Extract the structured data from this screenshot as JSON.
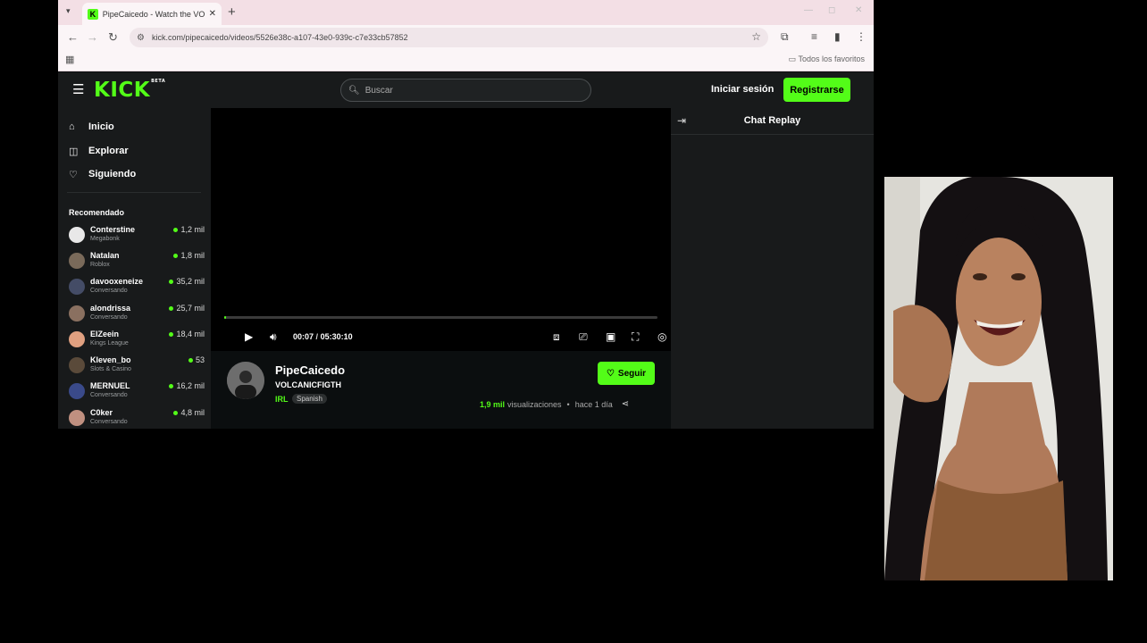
{
  "browser": {
    "tab_title": "PipeCaicedo - Watch the VOD o",
    "url": "kick.com/pipecaicedo/videos/5526e38c-a107-43e0-939c-c7e33cb57852",
    "bookmarks_label": "Todos los favoritos"
  },
  "kick": {
    "logo": "KICK",
    "logo_badge": "BETA",
    "search_placeholder": "Buscar",
    "login_label": "Iniciar sesión",
    "register_label": "Registrarse"
  },
  "sidebar": {
    "nav": [
      {
        "label": "Inicio",
        "icon": "home-icon"
      },
      {
        "label": "Explorar",
        "icon": "compass-icon"
      },
      {
        "label": "Siguiendo",
        "icon": "heart-icon"
      }
    ],
    "recommended_title": "Recomendado",
    "recommended": [
      {
        "name": "Conterstine",
        "category": "Megabonk",
        "viewers": "1,2 mil",
        "color": "#e8e8e8"
      },
      {
        "name": "Natalan",
        "category": "Roblox",
        "viewers": "1,8 mil",
        "color": "#7a6a5a"
      },
      {
        "name": "davooxeneize",
        "category": "Conversando",
        "viewers": "35,2 mil",
        "color": "#444c66"
      },
      {
        "name": "alondrissa",
        "category": "Conversando",
        "viewers": "25,7 mil",
        "color": "#8a7060"
      },
      {
        "name": "ElZeein",
        "category": "Kings League",
        "viewers": "18,4 mil",
        "color": "#e0a080"
      },
      {
        "name": "Kleven_bo",
        "category": "Slots & Casino",
        "viewers": "53",
        "color": "#5a4a3a"
      },
      {
        "name": "MERNUEL",
        "category": "Conversando",
        "viewers": "16,2 mil",
        "color": "#3a4a8a"
      },
      {
        "name": "C0ker",
        "category": "Conversando",
        "viewers": "4,8 mil",
        "color": "#c09080"
      }
    ]
  },
  "player": {
    "current_time": "00:07",
    "duration": "05:30:10",
    "progress": 0.0
  },
  "video": {
    "channel": "PipeCaicedo",
    "title": "VOLCANICFIGTH",
    "tag_category": "IRL",
    "tag_language": "Spanish",
    "follow_label": "Seguir",
    "views_count": "1,9 mil",
    "views_label": "visualizaciones",
    "age": "hace 1 día"
  },
  "chat": {
    "title": "Chat Replay"
  },
  "colors": {
    "kick_green": "#53fc18",
    "page_bg": "#0b0e0f",
    "panel_bg": "#181a1b"
  }
}
